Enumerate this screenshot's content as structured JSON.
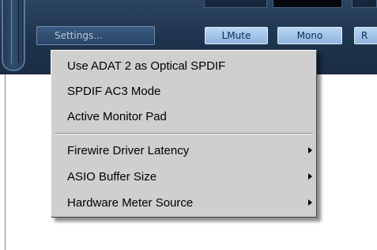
{
  "toolbar": {
    "settings_label": "Settings...",
    "lmute_label": "LMute",
    "mono_label": "Mono",
    "r_label": "R"
  },
  "menu": {
    "items": [
      {
        "label": "Use ADAT 2 as Optical SPDIF",
        "submenu": false
      },
      {
        "label": "SPDIF AC3 Mode",
        "submenu": false
      },
      {
        "label": "Active Monitor Pad",
        "submenu": false
      },
      {
        "label": "Firewire Driver Latency",
        "submenu": true
      },
      {
        "label": "ASIO Buffer Size",
        "submenu": true
      },
      {
        "label": "Hardware Meter Source",
        "submenu": true
      }
    ]
  },
  "colors": {
    "panel": "#1d324b",
    "button_blue": "#a6c6ea",
    "menu_bg": "#cfcfcf"
  }
}
